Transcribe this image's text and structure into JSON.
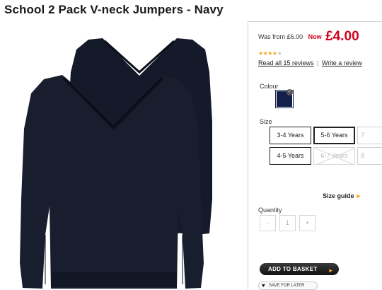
{
  "product": {
    "title": "School 2 Pack V-neck Jumpers - Navy"
  },
  "price": {
    "was": "Was from £6.00",
    "now_label": "Now",
    "now": "£4.00"
  },
  "rating": {
    "stars": 4.5,
    "out_of": 5,
    "read_reviews": "Read all 15 reviews",
    "separator": "|",
    "write_review": "Write a review"
  },
  "colour": {
    "label": "Colour",
    "selected_swatch": "#14204b"
  },
  "size": {
    "label": "Size",
    "options": [
      {
        "label": "3-4 Years",
        "state": "available"
      },
      {
        "label": "5-6 Years",
        "state": "selected"
      },
      {
        "label": "7",
        "state": "partially-visible"
      },
      {
        "label": "4-5 Years",
        "state": "available"
      },
      {
        "label": "6-7 Years",
        "state": "unavailable"
      },
      {
        "label": "8",
        "state": "partially-visible"
      }
    ],
    "guide": "Size guide",
    "guide_arrow": "►"
  },
  "quantity": {
    "label": "Quantity",
    "minus": "-",
    "value": "1",
    "plus": "+"
  },
  "actions": {
    "add_to_basket": "ADD TO BASKET",
    "add_icon": "►",
    "save_for_later": "SAVE FOR LATER"
  },
  "colors": {
    "price_red": "#d0021b",
    "accent_orange": "#f5a623",
    "navy": "#14204b",
    "button_dark": "#1a1a1a"
  }
}
